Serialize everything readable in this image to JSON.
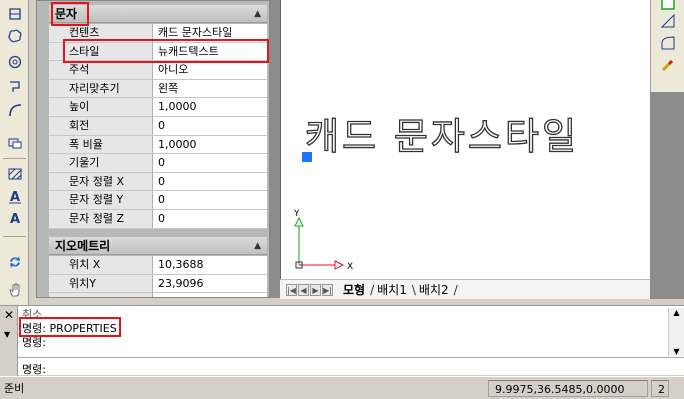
{
  "properties": {
    "categories": [
      {
        "label": "문자"
      },
      {
        "label": "지오메트리"
      }
    ],
    "text_rows": [
      {
        "key": "컨텐츠",
        "value": "캐드 문자스타일"
      },
      {
        "key": "스타일",
        "value": "뉴캐드텍스트"
      },
      {
        "key": "주석",
        "value": "아니오"
      },
      {
        "key": "자리맞추기",
        "value": "왼쪽"
      },
      {
        "key": "높이",
        "value": "1,0000"
      },
      {
        "key": "회전",
        "value": "0"
      },
      {
        "key": "폭 비율",
        "value": "1,0000"
      },
      {
        "key": "기울기",
        "value": "0"
      },
      {
        "key": "문자 정렬 X",
        "value": "0"
      },
      {
        "key": "문자 정렬 Y",
        "value": "0"
      },
      {
        "key": "문자 정렬 Z",
        "value": "0"
      }
    ],
    "geometry_rows": [
      {
        "key": "위치 X",
        "value": "10,3688"
      },
      {
        "key": "위치Y",
        "value": "23,9096"
      }
    ]
  },
  "drawing": {
    "text": "캐드 문자스타일",
    "ucs_x": "X",
    "ucs_y": "Y"
  },
  "tabs": [
    {
      "label": "모형"
    },
    {
      "label": "배치1"
    },
    {
      "label": "배치2"
    }
  ],
  "command": {
    "line0": "취소",
    "line1": "명령: PROPERTIES",
    "line2": "명령:",
    "prompt": "명령:"
  },
  "status": {
    "ready": "준비",
    "coords": "9.9975,36.5485,0.0000",
    "misc": "2"
  },
  "colors": {
    "highlight": "#e3141c",
    "grip": "#1e74ff"
  }
}
